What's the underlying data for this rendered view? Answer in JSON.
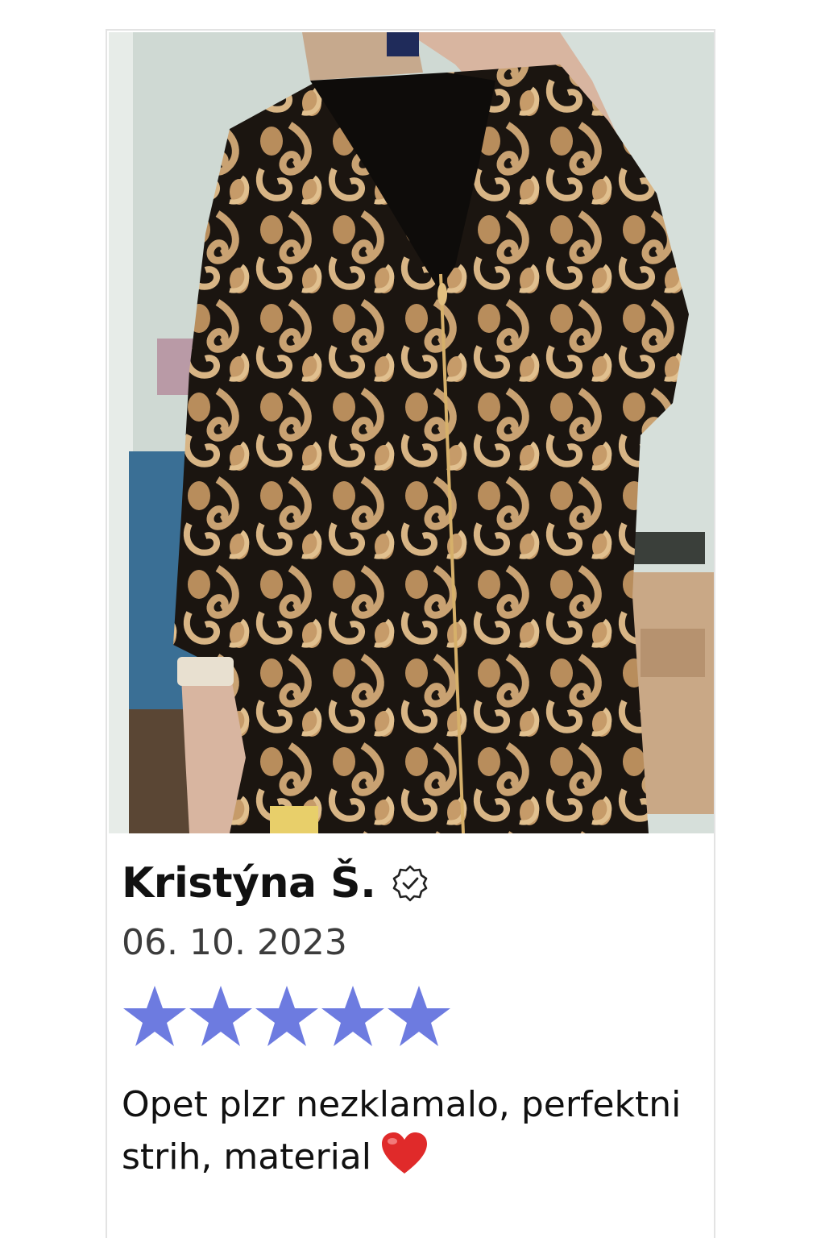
{
  "review": {
    "author": "Kristýna Š.",
    "verified_icon": "verified-badge-icon",
    "date": "06. 10. 2023",
    "rating": 5,
    "rating_max": 5,
    "star_color": "#6d7be0",
    "text": "Opet plzr nezklamalo, perfektni strih, material",
    "emoji": "heart-emoji"
  },
  "photo": {
    "description_icon": "review-photo"
  }
}
